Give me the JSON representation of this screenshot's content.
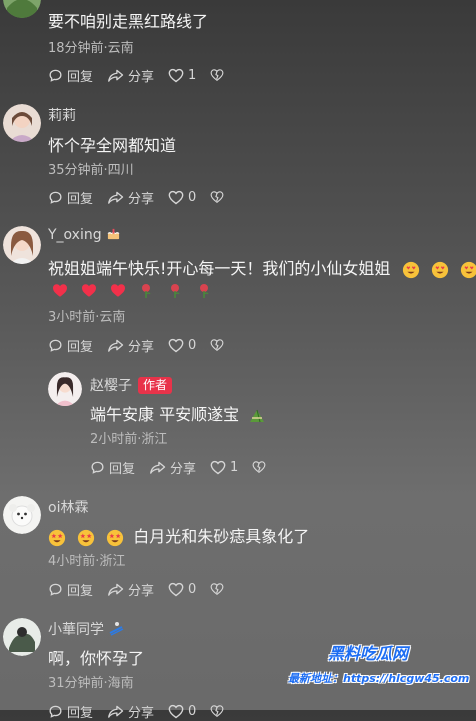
{
  "comments": [
    {
      "username": "",
      "text": "要不咱别走黑红路线了",
      "meta": "18分钟前·云南",
      "reply_label": "回复",
      "share_label": "分享",
      "like_count": "1"
    },
    {
      "username": "莉莉",
      "text": "怀个孕全网都知道",
      "meta": "35分钟前·四川",
      "reply_label": "回复",
      "share_label": "分享",
      "like_count": "0"
    },
    {
      "username": "Y_oxing",
      "text": "祝姐姐端午快乐!开心每一天！我们的小仙女姐姐",
      "meta": "3小时前·云南",
      "reply_label": "回复",
      "share_label": "分享",
      "like_count": "0"
    },
    {
      "username": "赵樱子",
      "badge": "作者",
      "text": "端午安康 平安顺遂宝",
      "meta": "2小时前·浙江",
      "reply_label": "回复",
      "share_label": "分享",
      "like_count": "1"
    },
    {
      "username": "oi林霖",
      "text": "白月光和朱砂痣具象化了",
      "meta": "4小时前·浙江",
      "reply_label": "回复",
      "share_label": "分享",
      "like_count": "0"
    },
    {
      "username": "小華同学",
      "text": "啊，你怀孕了",
      "meta": "31分钟前·海南",
      "reply_label": "回复",
      "share_label": "分享",
      "like_count": "0"
    }
  ],
  "watermark": {
    "title": "黑料吃瓜网",
    "line": "最新地址：https://hlcgw45.com"
  },
  "colors": {
    "badge": "#e8334a",
    "watermark": "#1d6df2"
  }
}
